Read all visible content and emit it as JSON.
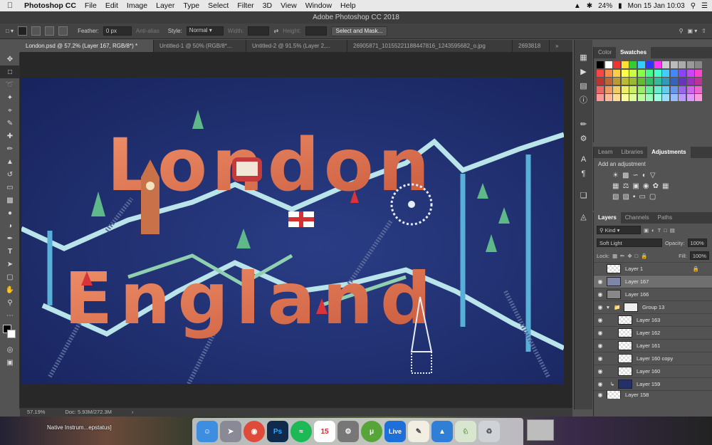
{
  "menubar": {
    "app": "Photoshop CC",
    "items": [
      "File",
      "Edit",
      "Image",
      "Layer",
      "Type",
      "Select",
      "Filter",
      "3D",
      "View",
      "Window",
      "Help"
    ],
    "battery": "24%",
    "clock": "Mon 15 Jan  10:03"
  },
  "window_title": "Adobe Photoshop CC 2018",
  "options": {
    "feather_label": "Feather:",
    "feather_value": "0 px",
    "antialias": "Anti-alias",
    "style_label": "Style:",
    "style_value": "Normal",
    "width_label": "Width:",
    "height_label": "Height:",
    "select_mask": "Select and Mask..."
  },
  "tabs": [
    "London.psd @ 57.2% (Layer 167, RGB/8*) *",
    "Untitled-1 @ 50% (RGB/8*...",
    "Untitled-2 @ 91.5% (Layer 2,...",
    "26905871_10155221188447816_1243595682_o.jpg",
    "2693818"
  ],
  "status": {
    "zoom": "57.19%",
    "doc": "Doc: 5.93M/272.3M"
  },
  "artwork": {
    "line1": "London",
    "line2": "England"
  },
  "swatch_panel": {
    "tab1": "Color",
    "tab2": "Swatches"
  },
  "adjust_panel": {
    "tab1": "Learn",
    "tab2": "Libraries",
    "tab3": "Adjustments",
    "title": "Add an adjustment"
  },
  "layers_panel": {
    "tab1": "Layers",
    "tab2": "Channels",
    "tab3": "Paths",
    "filter": "Kind",
    "blend": "Soft Light",
    "opacity_label": "Opacity:",
    "opacity": "100%",
    "lock_label": "Lock:",
    "fill_label": "Fill:",
    "fill": "100%",
    "layers": [
      "Layer 1",
      "Layer 167",
      "Layer 166",
      "Group 13",
      "Layer 163",
      "Layer 162",
      "Layer 161",
      "Layer 160 copy",
      "Layer 160",
      "Layer 159",
      "Layer 158"
    ]
  },
  "dock": {
    "desktop_label": "Native Instrum...epstatus]",
    "calendar_day": "15",
    "live_label": "Live"
  },
  "colors": {
    "canvas_bg": "#1c2a66",
    "letters": "#d9714f",
    "path": "#a8dbe0"
  }
}
